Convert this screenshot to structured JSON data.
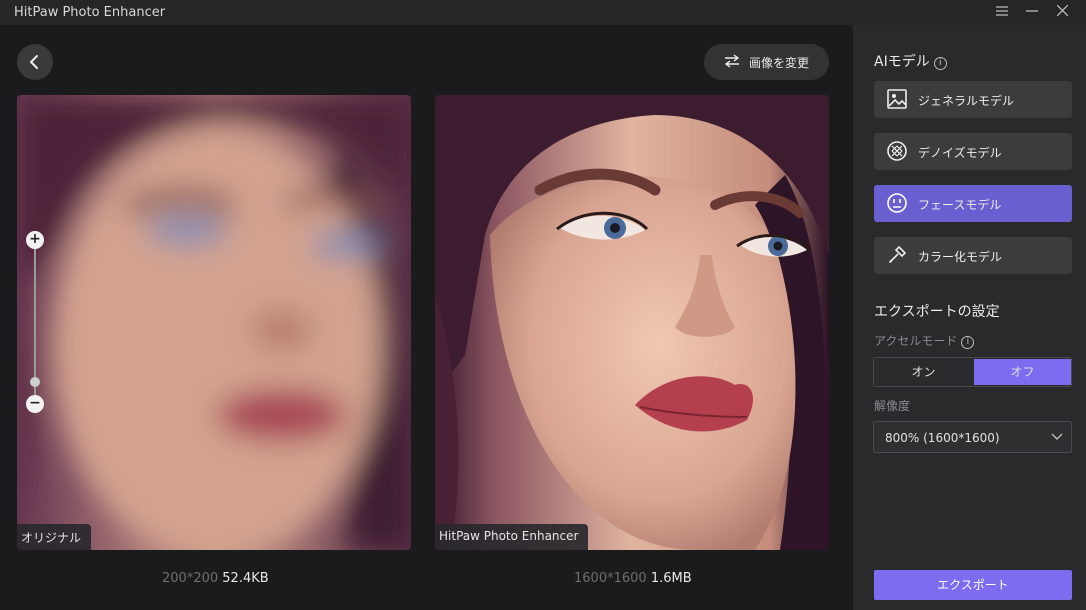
{
  "window": {
    "title": "HitPaw Photo Enhancer"
  },
  "toolbar": {
    "change_image_label": "画像を変更"
  },
  "preview": {
    "original": {
      "label": "オリジナル",
      "dimensions": "200*200",
      "size": "52.4KB"
    },
    "enhanced": {
      "label": "HitPaw Photo Enhancer",
      "dimensions": "1600*1600",
      "size": "1.6MB"
    },
    "zoom": {
      "plus": "+",
      "minus": "−"
    }
  },
  "sidebar": {
    "ai_model_title": "AIモデル",
    "models": [
      {
        "label": "ジェネラルモデル",
        "icon": "image-icon",
        "active": false
      },
      {
        "label": "デノイズモデル",
        "icon": "denoise-icon",
        "active": false
      },
      {
        "label": "フェースモデル",
        "icon": "face-icon",
        "active": true
      },
      {
        "label": "カラー化モデル",
        "icon": "colorize-icon",
        "active": false
      }
    ],
    "export_settings_title": "エクスポートの設定",
    "accel_mode_label": "アクセルモード",
    "accel_on": "オン",
    "accel_off": "オフ",
    "resolution_label": "解像度",
    "resolution_value": "800% (1600*1600)",
    "export_label": "エクスポート"
  },
  "colors": {
    "accent": "#7b6cf0",
    "active_model": "#6a5fd1",
    "sidebar_bg": "#2a2a2d",
    "main_bg": "#1b1b1d"
  }
}
